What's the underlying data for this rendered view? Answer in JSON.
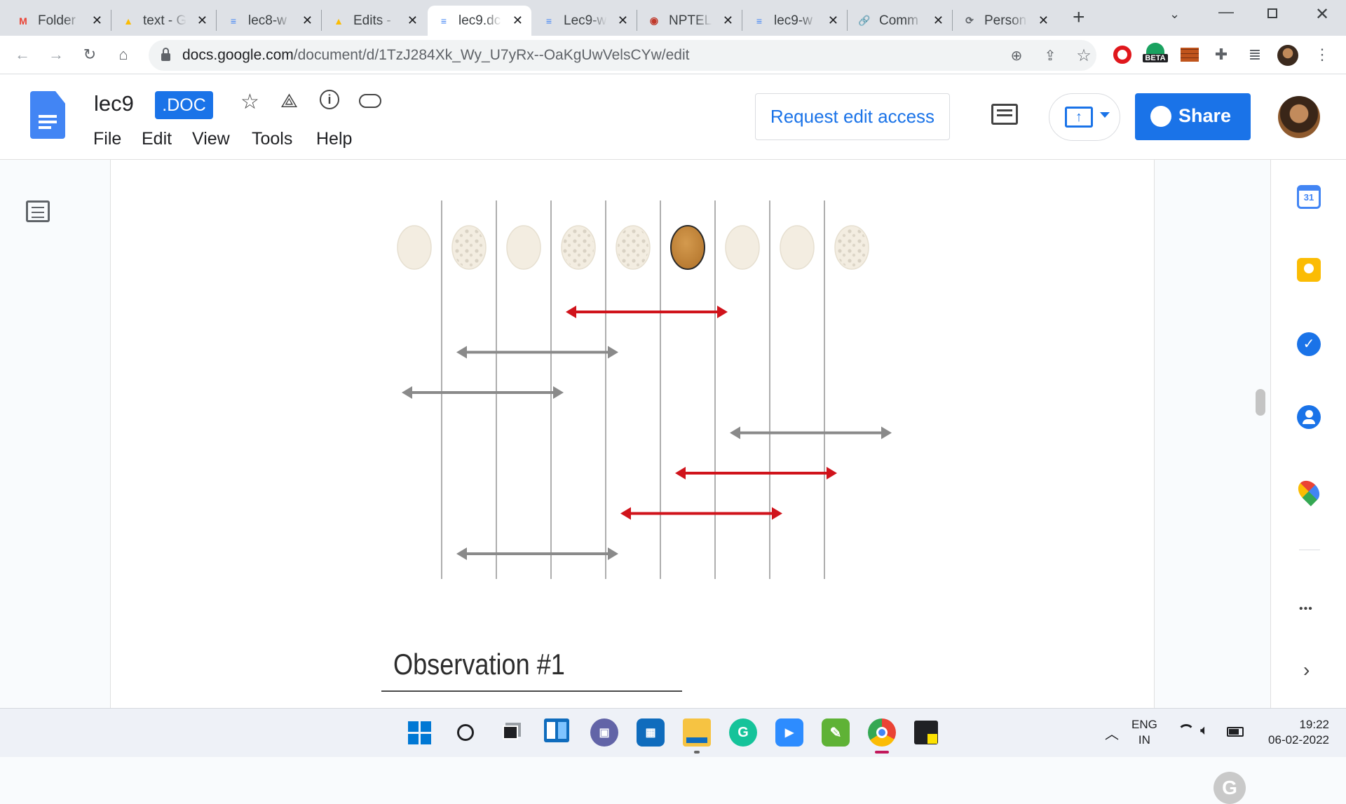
{
  "browser": {
    "tabs": [
      {
        "label": "Folder",
        "icon": "gmail-icon",
        "color": "#ea4335",
        "glyph": "M"
      },
      {
        "label": "text - G",
        "icon": "google-drive-icon",
        "color": "#fbbc04",
        "glyph": "▲"
      },
      {
        "label": "lec8-w",
        "icon": "google-docs-icon",
        "color": "#4285f4",
        "glyph": "≡"
      },
      {
        "label": "Edits -",
        "icon": "google-drive-icon",
        "color": "#fbbc04",
        "glyph": "▲"
      },
      {
        "label": "lec9.dc",
        "icon": "google-docs-icon",
        "color": "#4285f4",
        "glyph": "≡",
        "active": true
      },
      {
        "label": "Lec9-w",
        "icon": "google-docs-icon",
        "color": "#4285f4",
        "glyph": "≡"
      },
      {
        "label": "NPTEL",
        "icon": "nptel-icon",
        "color": "#c0392b",
        "glyph": "◉"
      },
      {
        "label": "lec9-w",
        "icon": "google-docs-icon",
        "color": "#4285f4",
        "glyph": "≡"
      },
      {
        "label": "Comm",
        "icon": "link-icon",
        "color": "#1a73e8",
        "glyph": "🔗"
      },
      {
        "label": "Person",
        "icon": "link-icon",
        "color": "#5f6368",
        "glyph": "⟳"
      }
    ],
    "url_host": "docs.google.com",
    "url_path": "/document/d/1TzJ284Xk_Wy_U7yRx--OaKgUwVelsCYw/edit",
    "beta_badge": "BETA"
  },
  "docs": {
    "title": "lec9",
    "format_badge": ".DOC",
    "menu": [
      "File",
      "Edit",
      "View",
      "Tools",
      "Help"
    ],
    "request_edit_label": "Request edit access",
    "share_label": "Share",
    "accent": "#1a73e8"
  },
  "figure": {
    "eggs": [
      {
        "type": "plain"
      },
      {
        "type": "speckled"
      },
      {
        "type": "plain"
      },
      {
        "type": "speckled"
      },
      {
        "type": "speckled"
      },
      {
        "type": "brown"
      },
      {
        "type": "plain"
      },
      {
        "type": "plain"
      },
      {
        "type": "speckled"
      }
    ],
    "intervals": [
      {
        "from": 3,
        "to": 5.5,
        "color": "red"
      },
      {
        "from": 1,
        "to": 3.5,
        "color": "gray"
      },
      {
        "from": 0,
        "to": 2.5,
        "color": "gray"
      },
      {
        "from": 6,
        "to": 8.5,
        "color": "gray"
      },
      {
        "from": 5,
        "to": 7.5,
        "color": "red"
      },
      {
        "from": 4,
        "to": 6.5,
        "color": "red"
      },
      {
        "from": 1,
        "to": 3.5,
        "color": "gray"
      }
    ],
    "red_color": "#d0131b",
    "gray_color": "#8a8a8a",
    "caption": "Observation #1"
  },
  "side_panel": {
    "calendar_day": "31",
    "more_label": "•••"
  },
  "taskbar": {
    "lang_top": "ENG",
    "lang_bottom": "IN",
    "time": "19:22",
    "date": "06-02-2022"
  }
}
